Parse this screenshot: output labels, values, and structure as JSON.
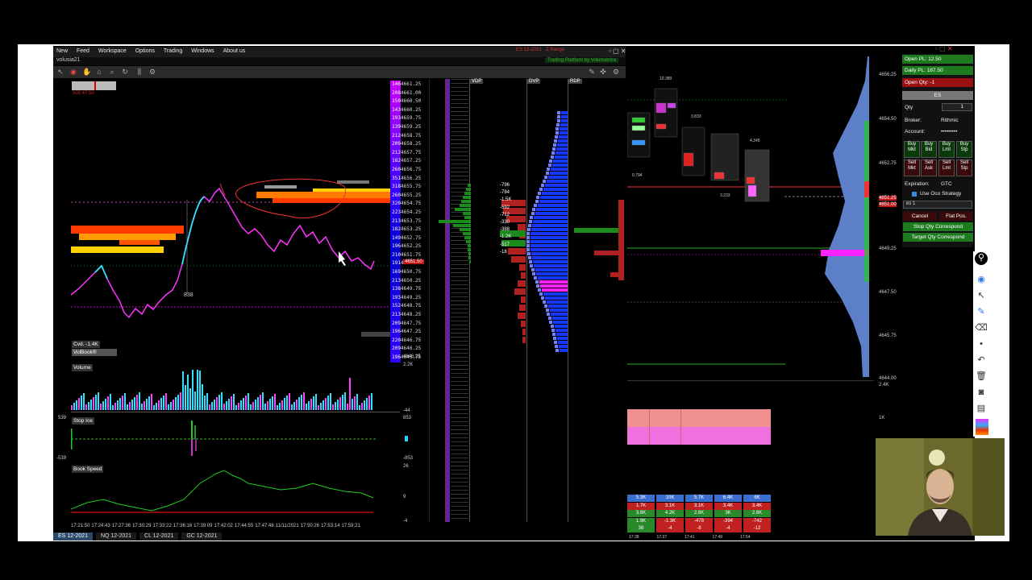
{
  "menu": {
    "items": [
      "New",
      "Feed",
      "Workspace",
      "Options",
      "Trading",
      "Windows",
      "About us"
    ],
    "username": "volusia21",
    "instrument_tag": "ES 12-2021 · Z Range",
    "platform_banner": "Trading Platform by Volumetrica"
  },
  "chart": {
    "cvd_label": "Cvd. -1.4K",
    "volbook_label": "VolBook®",
    "price_marker": "838",
    "left_tag": "505 47.50",
    "price_levels": [
      "4661.25",
      "4661.00",
      "4660.50",
      "4660.25",
      "4659.75",
      "4659.25",
      "4658.75",
      "4658.25",
      "4657.75",
      "4657.25",
      "4656.75",
      "4656.25",
      "4655.75",
      "4655.25",
      "4654.75",
      "4654.25",
      "4653.75",
      "4653.25",
      "4652.75",
      "4652.25",
      "4651.75",
      "4651.25",
      "4650.75",
      "4650.25",
      "4649.75",
      "4649.25",
      "4648.75",
      "4648.25",
      "4647.75",
      "4647.25",
      "4646.75",
      "4646.25",
      "4645.75"
    ],
    "size_levels": [
      "146",
      "208",
      "150",
      "143",
      "193",
      "139",
      "212",
      "209",
      "212",
      "182",
      "260",
      "351",
      "318",
      "260",
      "320",
      "223",
      "213",
      "182",
      "149",
      "196",
      "210",
      "191",
      "169",
      "213",
      "138",
      "193",
      "152",
      "213",
      "209",
      "196",
      "220",
      "209",
      "196"
    ],
    "bottom_price": "4646.25",
    "current_price_tag": "4651.50"
  },
  "indicators": {
    "volume_label": "Volume",
    "volume_max": "2.2K",
    "volume_min": "-44",
    "stopice_label": "Stop Ice",
    "stopice_top_left": "539",
    "stopice_bottom_left": "-539",
    "stopice_top_right": "853",
    "stopice_bottom_right": "-853",
    "bookspeed_label": "Book Speed",
    "bookspeed_top": "26",
    "bookspeed_mid": "9",
    "bookspeed_bottom": "-4"
  },
  "time_axis": [
    "17:21:50",
    "17:24:43",
    "17:27:36",
    "17:30:29",
    "17:33:22",
    "17:36:16",
    "17:39:09",
    "17:42:02",
    "17:44:55",
    "17:47:48",
    "11/11/2021",
    "17:50:26",
    "17:53:14",
    "17:59:21"
  ],
  "profile": {
    "headers": [
      "VDP",
      "DVP",
      "RDP"
    ],
    "delta_values": [
      "-796",
      "-784",
      "-1.5K",
      "-592",
      "-712",
      "-330",
      "-388",
      "-1.2K",
      "-517",
      "-18"
    ],
    "buy_values": [
      "300",
      "1.5K",
      "339"
    ]
  },
  "right_chart": {
    "prices": [
      "4656.25",
      "4654.50",
      "4652.75",
      "4651.25",
      "4651.00",
      "4649.25",
      "4647.50",
      "4645.75",
      "4644.00"
    ],
    "volume_axis": [
      "2.4K",
      "1K"
    ],
    "bubble_labels": [
      "10.389",
      "3.833",
      "4.345",
      "0.794",
      "3.233"
    ],
    "times": [
      "17:38",
      "17:37",
      "17:41",
      "17:49",
      "17:54"
    ]
  },
  "footgrid": {
    "rows": [
      [
        "5.3K",
        "10K",
        "5.7K",
        "6.4K",
        "6K"
      ],
      [
        "1.7K",
        "3.1K",
        "3.1K",
        "3.4K",
        "3.4K"
      ],
      [
        "3.6K",
        "4.2K",
        "2.6K",
        "3K",
        "2.6K"
      ],
      [
        "1.9K",
        "-1.3K",
        "-478",
        "-394",
        "-742"
      ],
      [
        "36",
        "-4",
        "-8",
        "-4",
        "-12"
      ]
    ]
  },
  "order_panel": {
    "open_pl": "Open PL: 12.50",
    "daily_pl": "Daily PL: 187.50",
    "open_qty": "Open Qty: -1",
    "symbol": "ES",
    "qty_label": "Qty",
    "qty_value": "1",
    "broker_label": "Broker:",
    "broker_value": "Rithmic",
    "account_label": "Account:",
    "account_value": "•••••••••",
    "buttons": [
      [
        "Buy",
        "Mkt"
      ],
      [
        "Buy",
        "Bid"
      ],
      [
        "Buy",
        "Lmt"
      ],
      [
        "Buy",
        "Stp"
      ],
      [
        "Sell",
        "Mkt"
      ],
      [
        "Sell",
        "Ask"
      ],
      [
        "Sell",
        "Lmt"
      ],
      [
        "Sell",
        "Stp"
      ]
    ],
    "expiration_label": "Expiration:",
    "expiration_value": "GTC",
    "oco_label": "Use Oco Strategy",
    "strategy_value": "es 1",
    "cancel": "Cancel",
    "flat_pos": "Flat Pos.",
    "stop_qty": "Stop Qty Correspond",
    "target_qty": "Target Qty Correspond"
  },
  "tabs": [
    "ES 12-2021",
    "NQ 12-2021",
    "CL 12-2021",
    "GC 12-2021"
  ],
  "colors": {
    "profit_green": "#1e7a1e",
    "loss_red": "#9a1010",
    "profile_blue": "#1438ff",
    "magenta": "#ff00ff",
    "cyan": "#33e0ff"
  }
}
